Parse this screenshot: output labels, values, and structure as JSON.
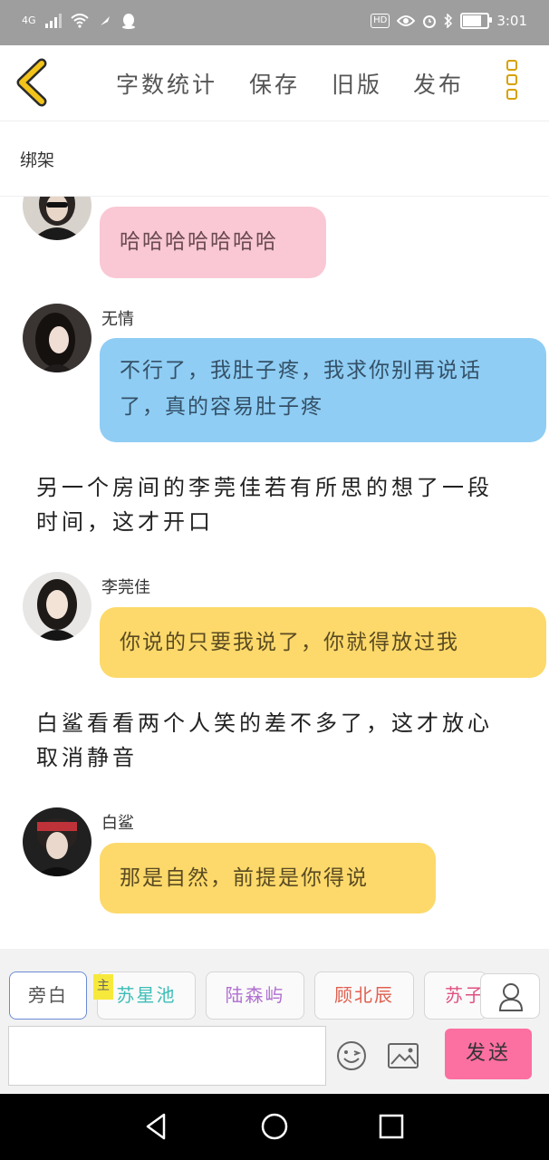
{
  "status_bar": {
    "network": "4G",
    "time": "3:01",
    "hd": "HD",
    "battery_level": 0.7
  },
  "toolbar": {
    "back_icon": "back-chevron-icon",
    "word_count_label": "字数统计",
    "save_label": "保存",
    "old_version_label": "旧版",
    "publish_label": "发布",
    "more_icon": "more-vertical-icon"
  },
  "chapter": {
    "title": "绑架"
  },
  "messages": [
    {
      "name": "",
      "text": "哈哈哈哈哈哈哈",
      "color": "#f9c8d4"
    },
    {
      "name": "无情",
      "text": "不行了，我肚子疼，我求你别再说话了，真的容易肚子疼",
      "color": "#8fcdf4"
    },
    {
      "name": "李莞佳",
      "text": "你说的只要我说了，你就得放过我",
      "color": "#fcd96a"
    },
    {
      "name": "白鲨",
      "text": "那是自然，前提是你得说",
      "color": "#fcd96a"
    }
  ],
  "narration": [
    "另一个房间的李莞佳若有所思的想了一段时间，这才开口",
    "白鲨看看两个人笑的差不多了，这才放心取消静音"
  ],
  "roles": [
    {
      "label": "旁白",
      "color": "#555555"
    },
    {
      "label": "苏星池",
      "color": "#3dbdb7"
    },
    {
      "label": "陆森屿",
      "color": "#b070d0"
    },
    {
      "label": "顾北辰",
      "color": "#e06050"
    },
    {
      "label": "苏子",
      "color": "#e05080"
    }
  ],
  "main_badge": "主",
  "input": {
    "value": "",
    "send_label": "发送",
    "emoji_icon": "emoji-icon",
    "image_icon": "image-icon",
    "user_icon": "user-icon"
  },
  "nav": {
    "back": "triangle-back-icon",
    "home": "circle-home-icon",
    "recent": "square-recent-icon"
  }
}
